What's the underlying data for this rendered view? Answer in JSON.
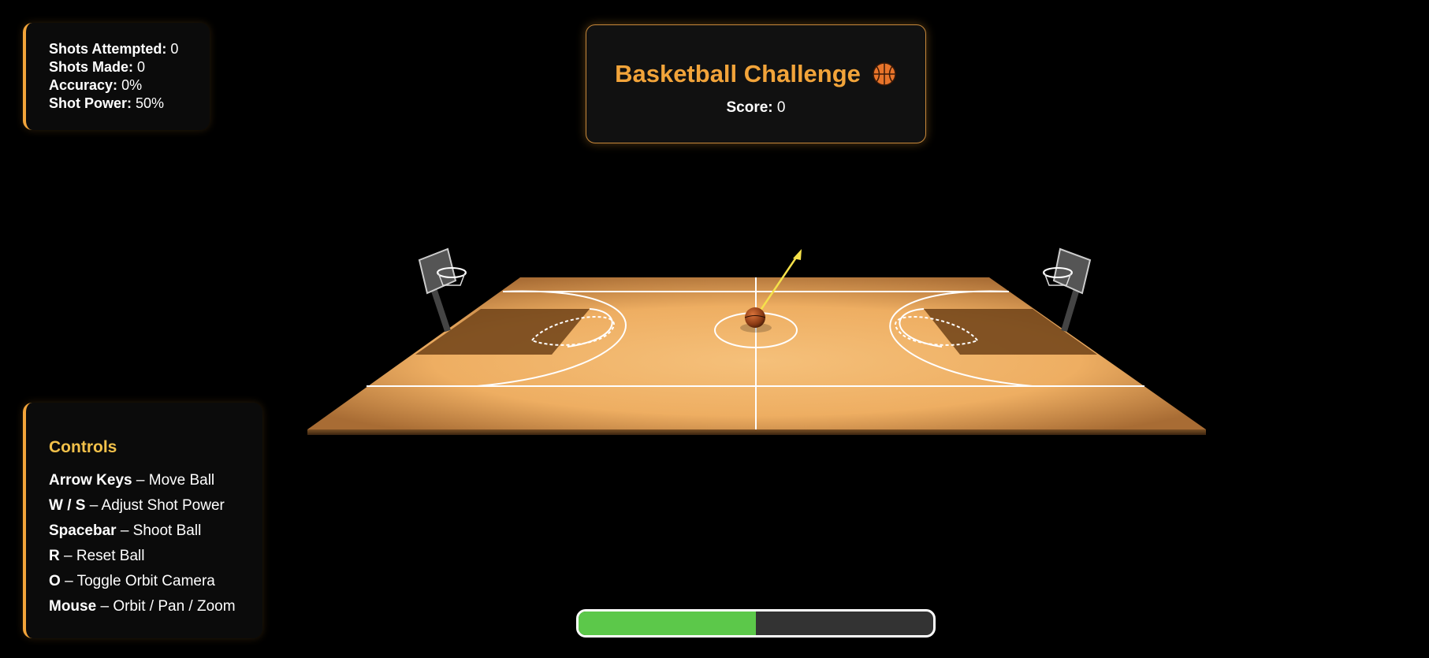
{
  "stats": {
    "attempted_label": "Shots Attempted:",
    "attempted_value": "0",
    "made_label": "Shots Made:",
    "made_value": "0",
    "accuracy_label": "Accuracy:",
    "accuracy_value": "0%",
    "power_label": "Shot Power:",
    "power_value": "50%"
  },
  "header": {
    "title": "Basketball Challenge",
    "icon": "basketball-icon",
    "score_label": "Score:",
    "score_value": "0"
  },
  "controls": {
    "title": "Controls",
    "items": [
      {
        "key": "Arrow Keys",
        "action": "– Move Ball"
      },
      {
        "key": "W / S",
        "action": "– Adjust Shot Power"
      },
      {
        "key": "Spacebar",
        "action": "– Shoot Ball"
      },
      {
        "key": "R",
        "action": "– Reset Ball"
      },
      {
        "key": "O",
        "action": "– Toggle Orbit Camera"
      },
      {
        "key": "Mouse",
        "action": "– Orbit / Pan / Zoom"
      }
    ]
  },
  "power_bar": {
    "fraction": 0.5,
    "fill_color": "#5cc84a"
  },
  "colors": {
    "accent": "#f2a43a",
    "court": "#f0b466",
    "background": "#000000"
  }
}
